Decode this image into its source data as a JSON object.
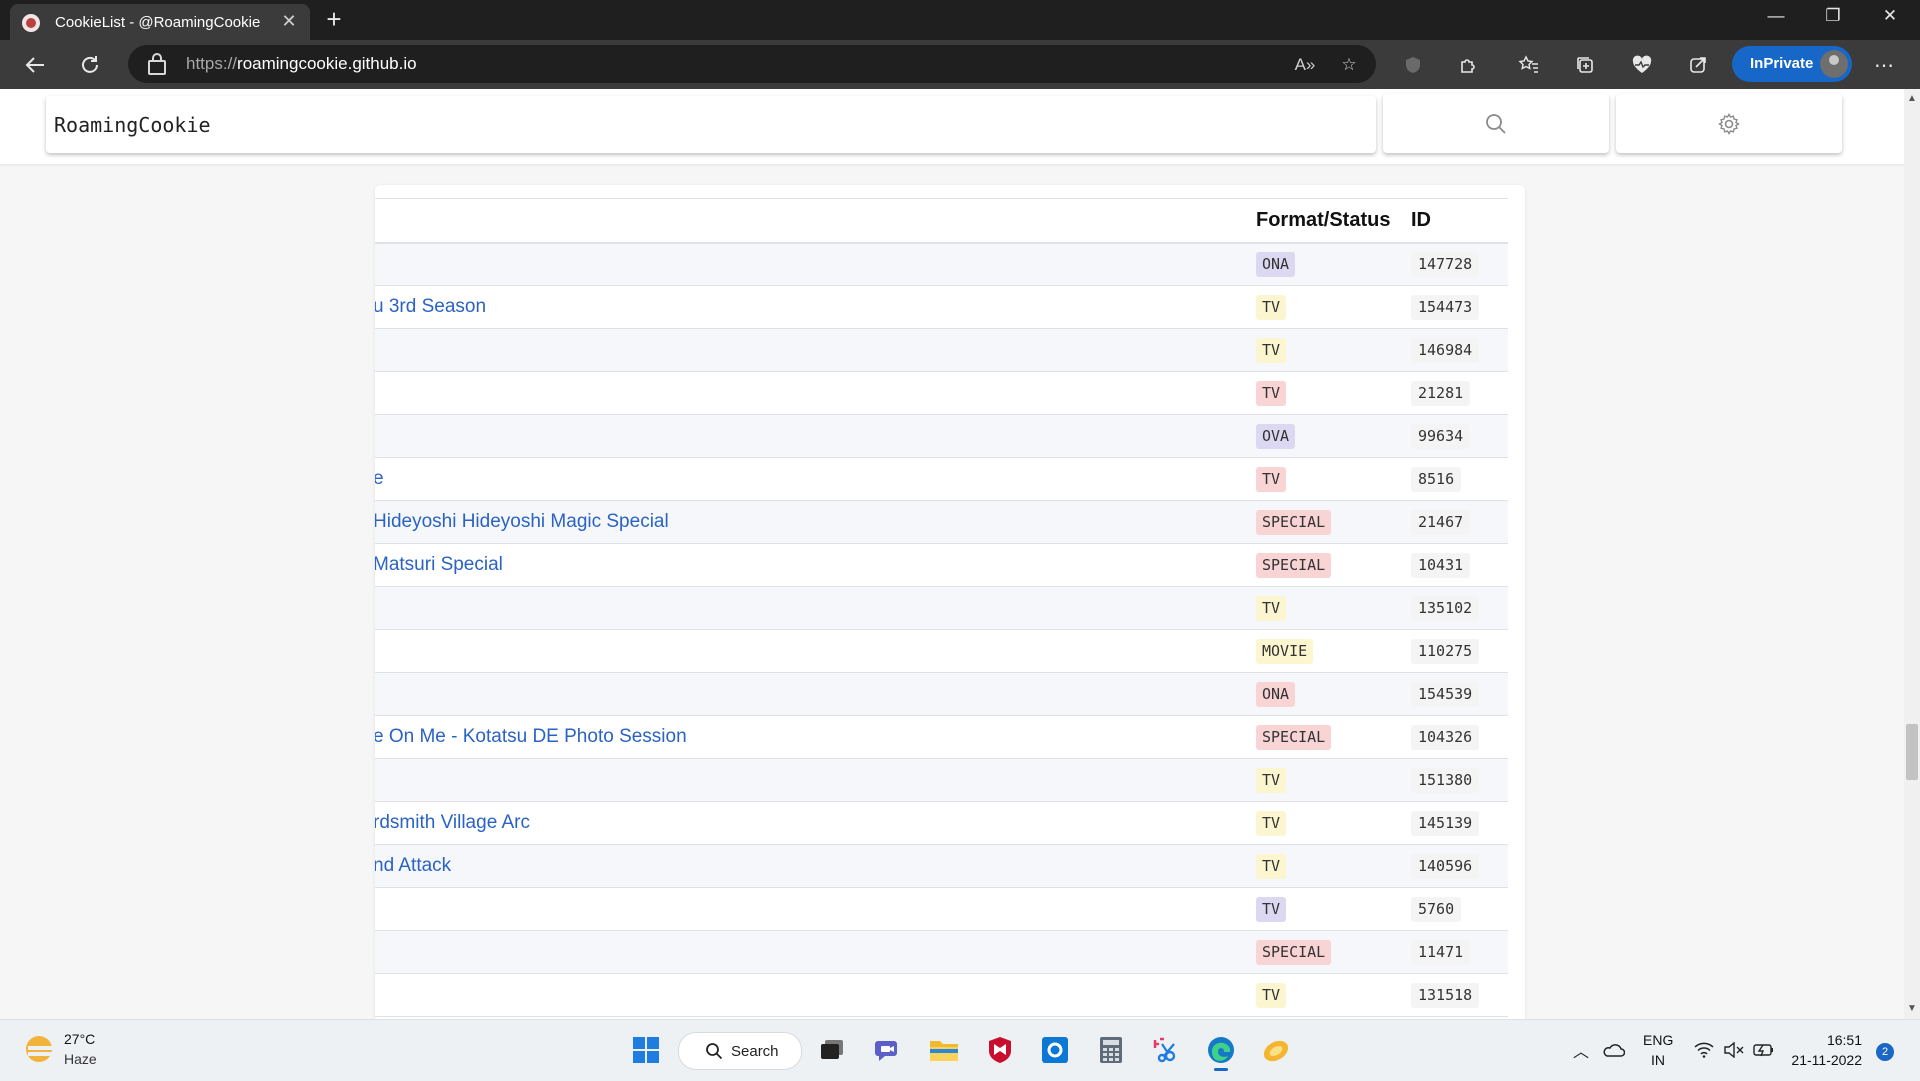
{
  "browser": {
    "tab_title": "CookieList - @RoamingCookie",
    "url_scheme": "https://",
    "url_host": "roamingcookie.github.io",
    "inprivate_label": "InPrivate"
  },
  "site": {
    "title": "RoamingCookie"
  },
  "table": {
    "columns": {
      "title": "",
      "format": "Format/Status",
      "id": "ID"
    },
    "rows": [
      {
        "title": "",
        "format": "ONA",
        "badge_color": "#dcd8f2",
        "id": "147728"
      },
      {
        "title": "u 3rd Season",
        "format": "TV",
        "badge_color": "#fbf6cf",
        "id": "154473"
      },
      {
        "title": "",
        "format": "TV",
        "badge_color": "#fbf6cf",
        "id": "146984"
      },
      {
        "title": "",
        "format": "TV",
        "badge_color": "#f8d4d4",
        "id": "21281"
      },
      {
        "title": "",
        "format": "OVA",
        "badge_color": "#dcd8f2",
        "id": "99634"
      },
      {
        "title": "e",
        "format": "TV",
        "badge_color": "#f8d4d4",
        "id": "8516"
      },
      {
        "title": "Hideyoshi Hideyoshi Magic Special",
        "format": "SPECIAL",
        "badge_color": "#f8d4d4",
        "id": "21467"
      },
      {
        "title": "Matsuri Special",
        "format": "SPECIAL",
        "badge_color": "#f8d4d4",
        "id": "10431"
      },
      {
        "title": "",
        "format": "TV",
        "badge_color": "#fbf6cf",
        "id": "135102"
      },
      {
        "title": "",
        "format": "MOVIE",
        "badge_color": "#fbf6cf",
        "id": "110275"
      },
      {
        "title": "",
        "format": "ONA",
        "badge_color": "#f8d4d4",
        "id": "154539"
      },
      {
        "title": "e On Me - Kotatsu DE Photo Session",
        "format": "SPECIAL",
        "badge_color": "#f8d4d4",
        "id": "104326"
      },
      {
        "title": "",
        "format": "TV",
        "badge_color": "#fbf6cf",
        "id": "151380"
      },
      {
        "title": "rdsmith Village Arc",
        "format": "TV",
        "badge_color": "#fbf6cf",
        "id": "145139"
      },
      {
        "title": "nd Attack",
        "format": "TV",
        "badge_color": "#fbf6cf",
        "id": "140596"
      },
      {
        "title": "",
        "format": "TV",
        "badge_color": "#dcd8f2",
        "id": "5760"
      },
      {
        "title": "",
        "format": "SPECIAL",
        "badge_color": "#f8d4d4",
        "id": "11471"
      },
      {
        "title": "",
        "format": "TV",
        "badge_color": "#fbf6cf",
        "id": "131518"
      }
    ]
  },
  "taskbar": {
    "weather_temp": "27°C",
    "weather_desc": "Haze",
    "search_label": "Search",
    "lang_line1": "ENG",
    "lang_line2": "IN",
    "time": "16:51",
    "date": "21-11-2022",
    "notification_count": "2"
  },
  "colors": {
    "link": "#2a63c3",
    "badge_purple": "#dcd8f2",
    "badge_yellow": "#fbf6cf",
    "badge_red": "#f8d4d4",
    "inprivate": "#1667c7"
  }
}
